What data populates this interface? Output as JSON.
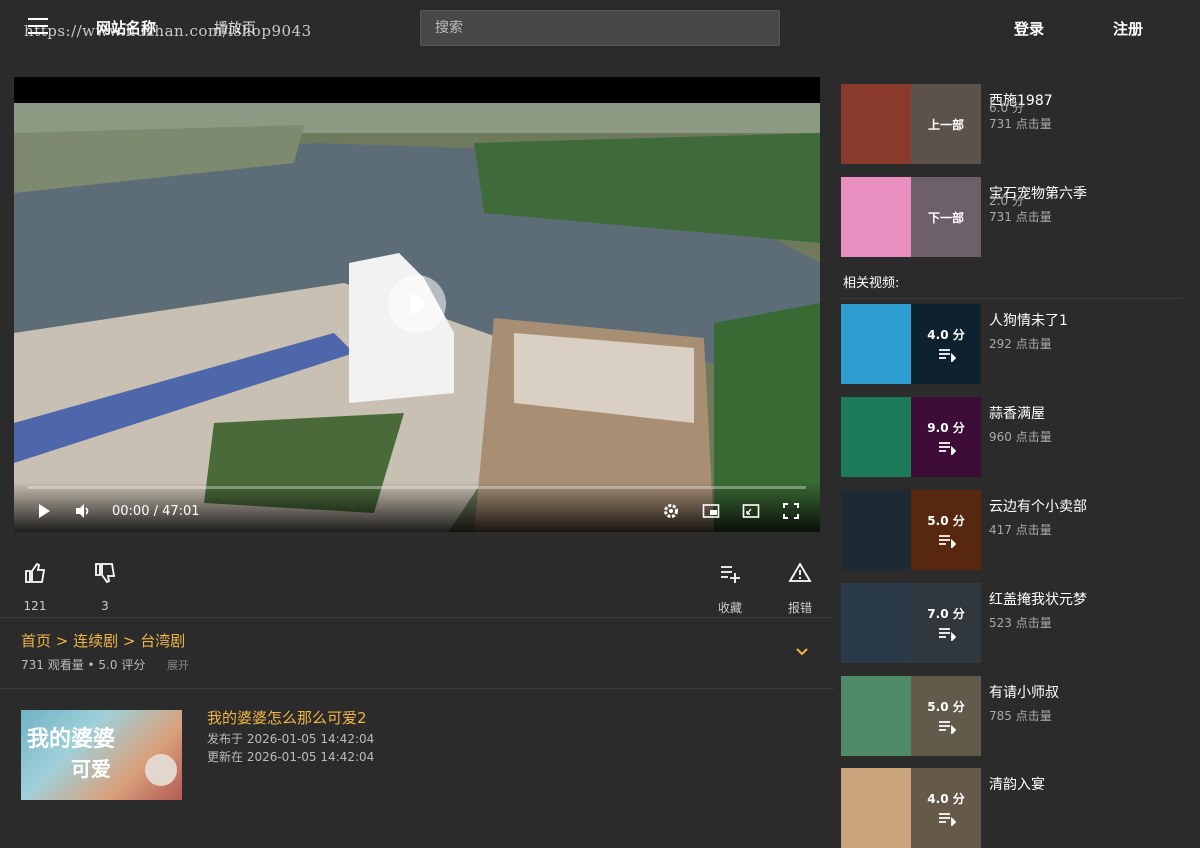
{
  "header": {
    "site_name": "网站名称",
    "page_label": "播放页",
    "watermark": "https://www.huzhan.com/ishop9043",
    "search_placeholder": "搜索",
    "login": "登录",
    "register": "注册"
  },
  "player": {
    "time": "00:00 / 47:01"
  },
  "actions": {
    "like_count": "121",
    "dislike_count": "3",
    "collect": "收藏",
    "report": "报错"
  },
  "info": {
    "breadcrumb": "首页 > 连续剧 > 台湾剧",
    "meta": "731 观看量 • 5.0 评分",
    "expand": "展开"
  },
  "episode": {
    "title": "我的婆婆怎么那么可爱2",
    "published": "发布于 2026-01-05 14:42:04",
    "updated": "更新在 2026-01-05 14:42:04"
  },
  "nav_items": [
    {
      "label": "上一部",
      "title": "西施1987",
      "score": "6.0 分",
      "views": "731 点击量",
      "color_a": "#8a3a2c",
      "color_b": "#c9b9a6"
    },
    {
      "label": "下一部",
      "title": "宝石宠物第六季",
      "score": "2.0 分",
      "views": "731 点击量",
      "color_a": "#e88fc0",
      "color_b": "#f3d4e6"
    }
  ],
  "related_heading": "相关视频:",
  "related": [
    {
      "title": "人狗情未了1",
      "score": "4.0 分",
      "views": "292 点击量",
      "color_a": "#2e9ed0",
      "color_b": "#1f4b66"
    },
    {
      "title": "蒜香满屋",
      "score": "9.0 分",
      "views": "960 点击量",
      "color_a": "#1a7a5a",
      "color_b": "#8a1d7a"
    },
    {
      "title": "云边有个小卖部",
      "score": "5.0 分",
      "views": "417 点击量",
      "color_a": "#1d2a33",
      "color_b": "#c05a22"
    },
    {
      "title": "红盖掩我状元梦",
      "score": "7.0 分",
      "views": "523 点击量",
      "color_a": "#2a3a48",
      "color_b": "#6a7a88"
    },
    {
      "title": "有请小师叔",
      "score": "5.0 分",
      "views": "785 点击量",
      "color_a": "#4e8a66",
      "color_b": "#d9c9a8"
    },
    {
      "title": "清韵入宴",
      "score": "4.0 分",
      "views": "",
      "color_a": "#c9a37a",
      "color_b": "#e0c6a4"
    }
  ]
}
